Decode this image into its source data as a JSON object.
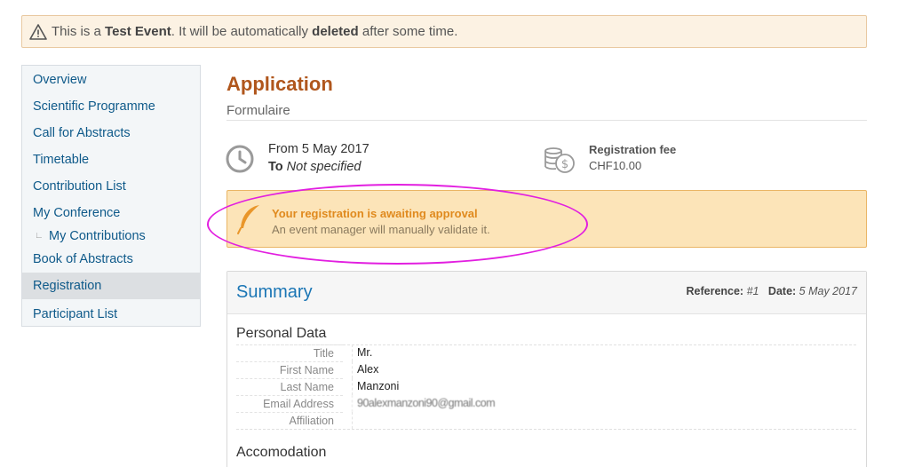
{
  "banner": {
    "prefix": "This is a ",
    "strong1": "Test Event",
    "middle": ". It will be automatically ",
    "strong2": "deleted",
    "suffix": " after some time.",
    "icon": "warning-icon"
  },
  "sidebar": {
    "items": [
      {
        "label": "Overview"
      },
      {
        "label": "Scientific Programme"
      },
      {
        "label": "Call for Abstracts"
      },
      {
        "label": "Timetable"
      },
      {
        "label": "Contribution List"
      },
      {
        "label": "My Conference"
      },
      {
        "label": "My Contributions"
      },
      {
        "label": "Book of Abstracts"
      },
      {
        "label": "Registration"
      },
      {
        "label": "Participant List"
      }
    ],
    "sub_marker": "∟"
  },
  "main": {
    "title": "Application",
    "subtitle": "Formulaire",
    "date_from": "From 5 May 2017",
    "date_to_label": "To",
    "date_to_value": "Not specified",
    "fee_label": "Registration fee",
    "fee_value": "CHF10.00"
  },
  "approval": {
    "title": "Your registration is awaiting approval",
    "text": "An event manager will manually validate it."
  },
  "summary": {
    "title": "Summary",
    "reference_label": "Reference:",
    "reference_value": "#1",
    "date_label": "Date:",
    "date_value": "5 May 2017",
    "personal_title": "Personal Data",
    "rows": [
      {
        "label": "Title",
        "value": "Mr."
      },
      {
        "label": "First Name",
        "value": "Alex"
      },
      {
        "label": "Last Name",
        "value": "Manzoni"
      },
      {
        "label": "Email Address",
        "value": "90alexmanzoni90@gmail.com"
      },
      {
        "label": "Affiliation",
        "value": ""
      }
    ],
    "accommodation_title": "Accomodation"
  },
  "colors": {
    "accent": "#b0561c",
    "link": "#0f5a8a",
    "summary": "#1b76b5",
    "approval_bg": "#fce4b8",
    "highlight": "#e21fe0"
  }
}
